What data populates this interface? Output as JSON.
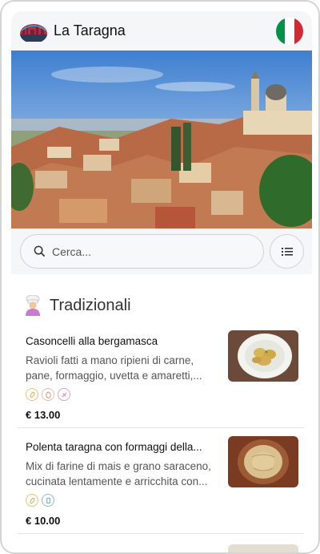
{
  "app": {
    "title": "La Taragna"
  },
  "colors": {
    "flag_green": "#009246",
    "flag_white": "#ffffff",
    "flag_red": "#ce2b37"
  },
  "search": {
    "placeholder": "Cerca..."
  },
  "section": {
    "title": "Tradizionali",
    "icon": "chef-icon"
  },
  "dishes": [
    {
      "name": "Casoncelli alla bergamasca",
      "description": "Ravioli fatti a mano ripieni di carne, pane, formaggio, uvetta e amaretti,...",
      "price": "€ 13.00",
      "allergens": [
        "gluten-icon",
        "egg-icon",
        "milk-icon"
      ]
    },
    {
      "name": "Polenta taragna con formaggi della...",
      "description": "Mix di farine di mais e grano saraceno, cucinata lentamente e arricchita con...",
      "price": "€ 10.00",
      "allergens": [
        "gluten-icon",
        "dairy-icon"
      ]
    }
  ]
}
